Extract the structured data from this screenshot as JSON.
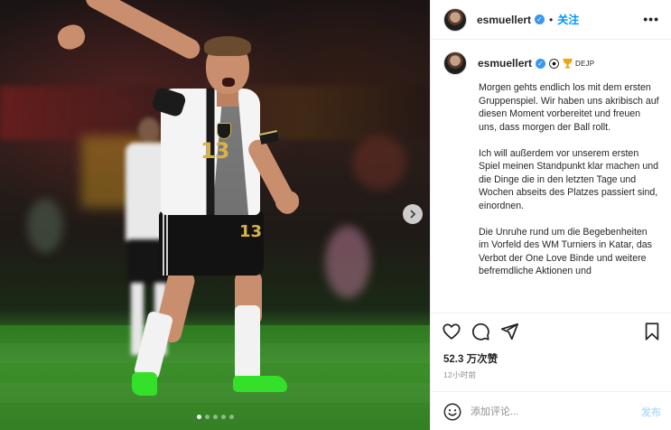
{
  "post": {
    "image_alt": "Football player in white German jersey number 13 gesturing on the pitch",
    "carousel": {
      "total_slides": 5,
      "active_slide": 1
    }
  },
  "header": {
    "username": "esmuellert",
    "follow_label": "关注",
    "more_label": "•••"
  },
  "caption": {
    "username": "esmuellert",
    "tag": "DEJP",
    "paragraphs": [
      "Morgen gehts endlich los mit dem ersten Gruppenspiel. Wir haben uns akribisch auf diesen Moment vorbereitet und freuen uns, dass morgen der Ball rollt.",
      "Ich will außerdem vor unserem ersten Spiel meinen Standpunkt klar machen und die Dinge die in den letzten Tage und Wochen abseits des Platzes passiert sind, einordnen.",
      "Die Unruhe rund um die Begebenheiten im Vorfeld des WM Turniers in Katar, das Verbot der One Love Binde und weitere befremdliche Aktionen und"
    ]
  },
  "engagement": {
    "likes": "52.3 万次赞",
    "timestamp": "12小时前"
  },
  "comment": {
    "placeholder": "添加评论...",
    "post_label": "发布"
  },
  "colors": {
    "link_blue": "#0095f6",
    "verified_blue": "#3897f0",
    "muted": "#8e8e8e",
    "boots": "#35e02a"
  },
  "icons": {
    "like": "heart-icon",
    "comment": "comment-icon",
    "share": "paper-plane-icon",
    "save": "bookmark-icon",
    "emoji": "smiley-icon",
    "next": "chevron-right-icon",
    "more": "ellipsis-icon"
  }
}
